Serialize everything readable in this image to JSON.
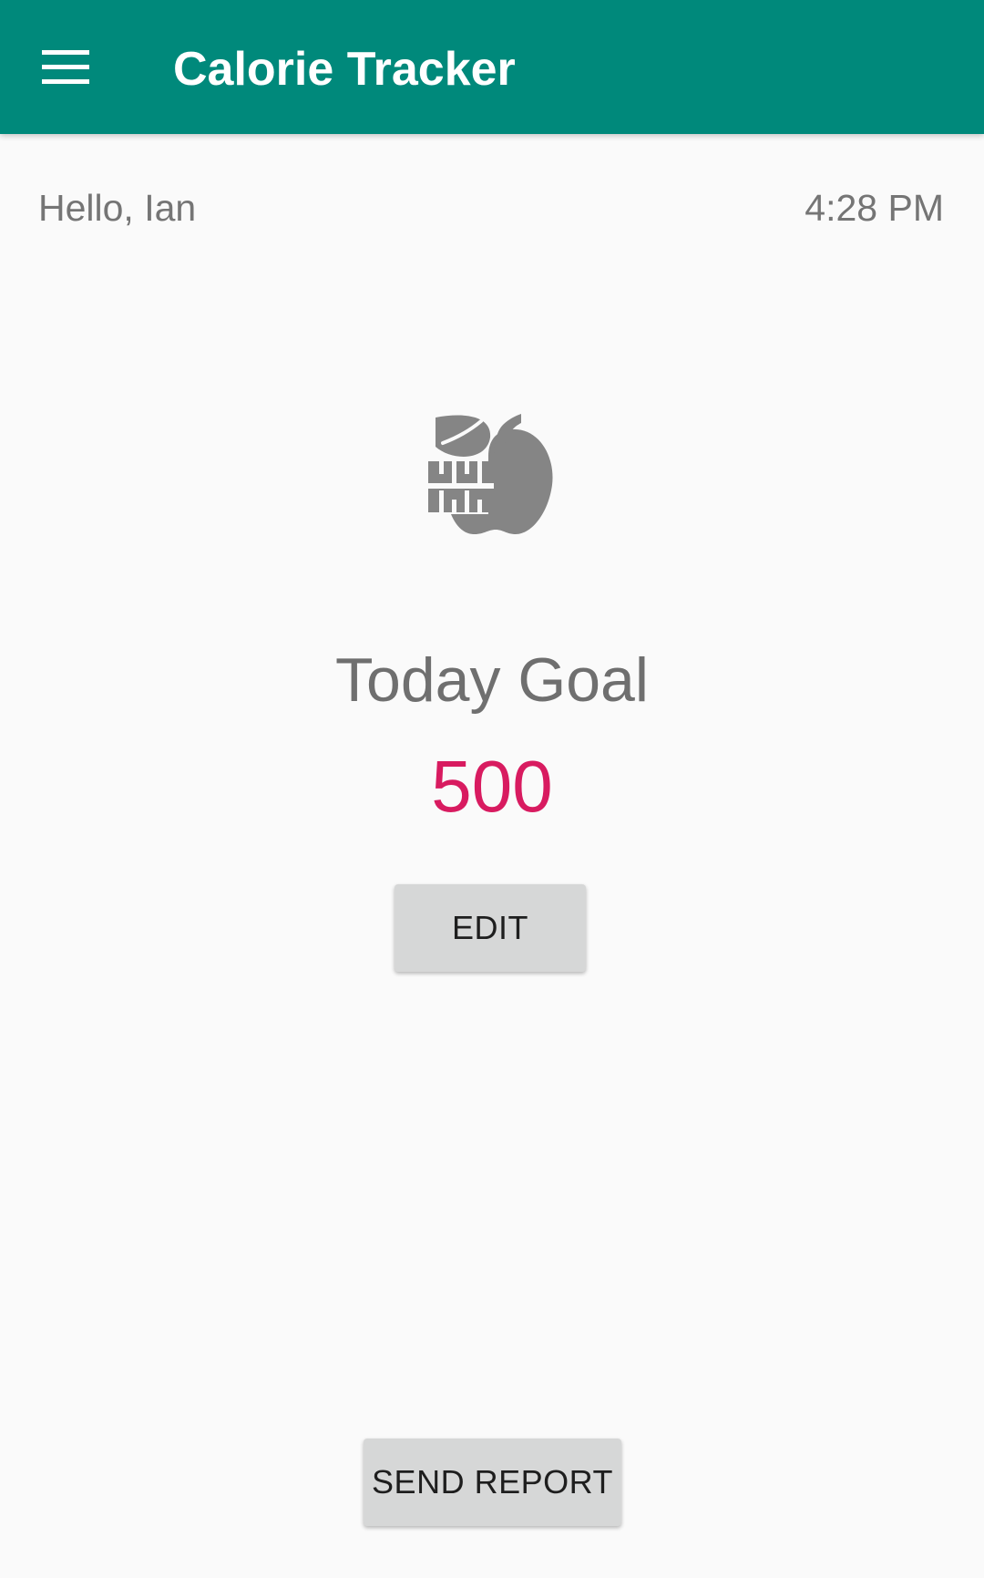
{
  "app_bar": {
    "title": "Calorie Tracker",
    "menu_icon": "hamburger-menu-icon",
    "background": "#00897b"
  },
  "header": {
    "greeting": "Hello, Ian",
    "time": "4:28 PM"
  },
  "goal": {
    "icon": "apple-measuring-tape-icon",
    "label": "Today Goal",
    "value": "500",
    "value_color": "#d81b60"
  },
  "actions": {
    "edit_label": "EDIT",
    "send_report_label": "SEND REPORT"
  }
}
